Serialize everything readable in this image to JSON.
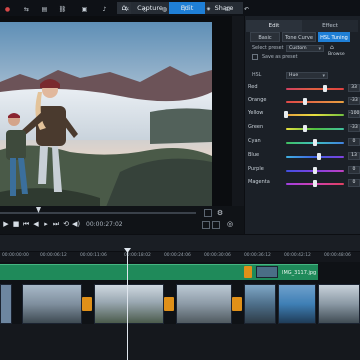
{
  "nav": {
    "home_glyph": "⌂",
    "tabs": [
      {
        "label": "Capture",
        "active": false
      },
      {
        "label": "Edit",
        "active": true
      },
      {
        "label": "Share",
        "active": false
      }
    ]
  },
  "preview": {
    "timecode": "00:00:27:02",
    "status_readout": "00:00:00:00",
    "zoom": "99"
  },
  "panel": {
    "tabs": [
      {
        "label": "Edit",
        "active": true
      },
      {
        "label": "Effect",
        "active": false
      }
    ],
    "subtabs": [
      {
        "label": "Basic",
        "active": false
      },
      {
        "label": "Tone Curve",
        "active": false
      },
      {
        "label": "HSL Tuning",
        "active": true
      }
    ],
    "select_preset_label": "Select preset",
    "preset_value": "Custom",
    "browse_label": "Browse",
    "save_as_preset_label": "Save as preset",
    "hsl_label": "HSL",
    "hsl_mode": "Hue",
    "rows": [
      {
        "label": "Red",
        "value": "33"
      },
      {
        "label": "Orange",
        "value": "-33"
      },
      {
        "label": "Yellow",
        "value": "-100"
      },
      {
        "label": "Green",
        "value": "-33"
      },
      {
        "label": "Cyan",
        "value": "0"
      },
      {
        "label": "Blue",
        "value": "13"
      },
      {
        "label": "Purple",
        "value": "0"
      },
      {
        "label": "Magenta",
        "value": "0"
      }
    ]
  },
  "timeline": {
    "ticks": [
      "00:00:00:00",
      "00:00:06:12",
      "00:00:11:06",
      "00:00:18:02",
      "00:00:24:06",
      "00:00:30:06",
      "00:00:36:12",
      "00:00:42:12",
      "00:00:48:06"
    ],
    "clip_label": "IMG_3117.jpg"
  },
  "colors": {
    "accent": "#1f7fd6",
    "clip_green": "#1f8a5a",
    "transition_orange": "#e09018"
  }
}
